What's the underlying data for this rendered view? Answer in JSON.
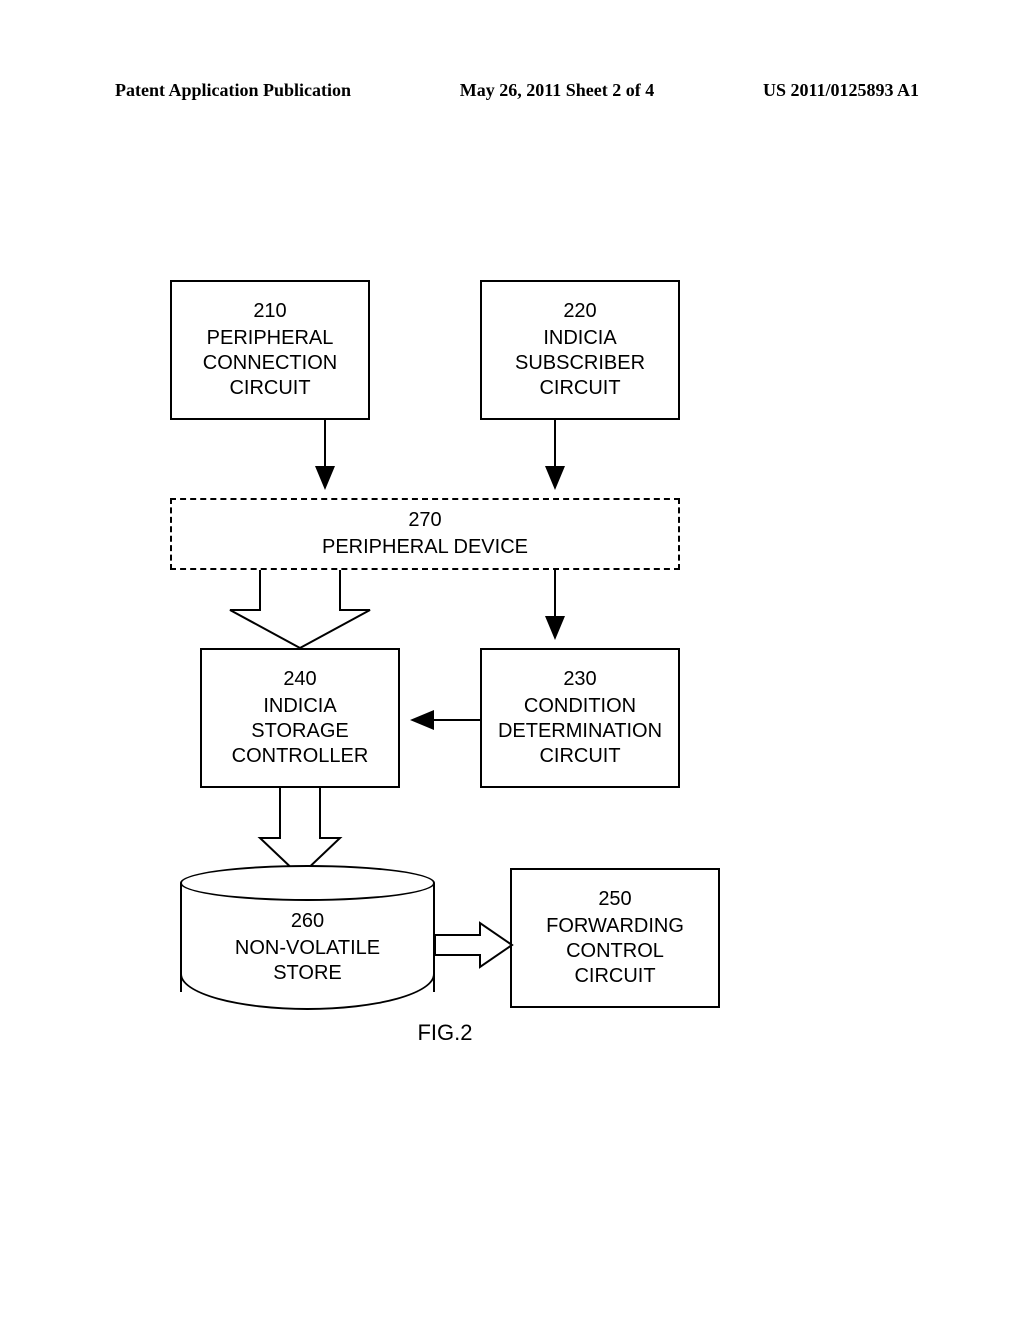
{
  "header": {
    "left": "Patent Application Publication",
    "center": "May 26, 2011  Sheet 2 of 4",
    "right": "US 2011/0125893 A1"
  },
  "blocks": {
    "b210": {
      "num": "210",
      "line1": "PERIPHERAL",
      "line2": "CONNECTION",
      "line3": "CIRCUIT"
    },
    "b220": {
      "num": "220",
      "line1": "INDICIA",
      "line2": "SUBSCRIBER",
      "line3": "CIRCUIT"
    },
    "b270": {
      "num": "270",
      "line1": "PERIPHERAL DEVICE"
    },
    "b240": {
      "num": "240",
      "line1": "INDICIA",
      "line2": "STORAGE",
      "line3": "CONTROLLER"
    },
    "b230": {
      "num": "230",
      "line1": "CONDITION",
      "line2": "DETERMINATION",
      "line3": "CIRCUIT"
    },
    "b260": {
      "num": "260",
      "line1": "NON-VOLATILE",
      "line2": "STORE"
    },
    "b250": {
      "num": "250",
      "line1": "FORWARDING",
      "line2": "CONTROL",
      "line3": "CIRCUIT"
    }
  },
  "figure_caption": "FIG.2"
}
